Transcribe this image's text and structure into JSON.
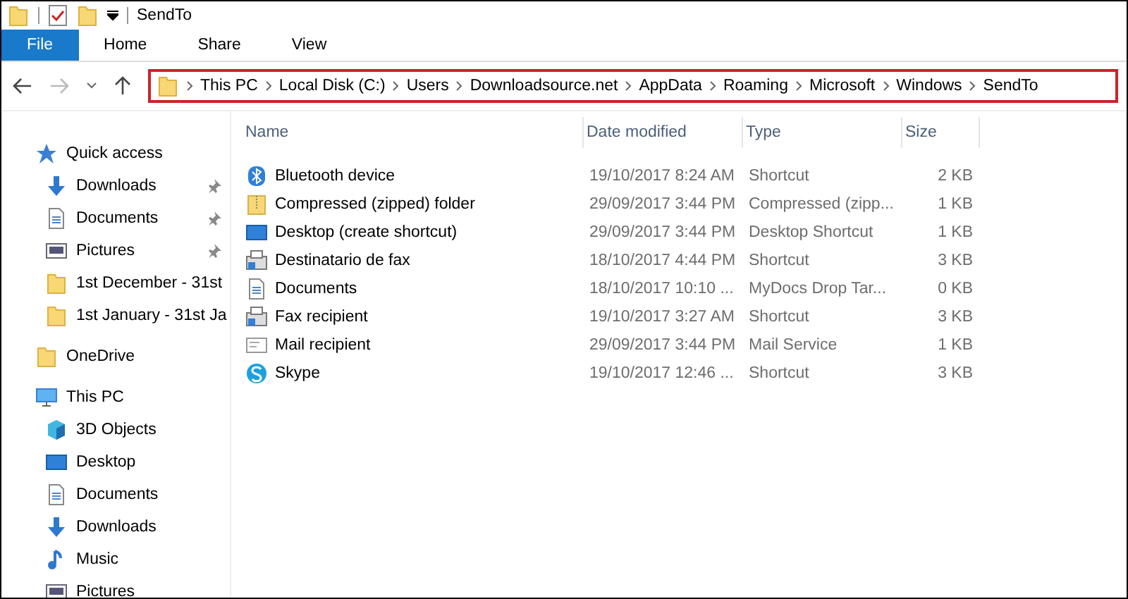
{
  "window": {
    "title": "SendTo"
  },
  "ribbon_tabs": [
    {
      "label": "File",
      "kind": "file",
      "selected": false
    },
    {
      "label": "Home",
      "kind": "tab",
      "selected": false
    },
    {
      "label": "Share",
      "kind": "tab",
      "selected": false
    },
    {
      "label": "View",
      "kind": "tab",
      "selected": false
    }
  ],
  "address_bar": {
    "highlighted": true,
    "path": [
      "This PC",
      "Local Disk (C:)",
      "Users",
      "Downloadsource.net",
      "AppData",
      "Roaming",
      "Microsoft",
      "Windows",
      "SendTo"
    ]
  },
  "sidebar": {
    "groups": [
      {
        "label": "Quick access",
        "kind": "star",
        "items": [
          {
            "label": "Downloads",
            "kind": "download",
            "pinned": true
          },
          {
            "label": "Documents",
            "kind": "document",
            "pinned": true
          },
          {
            "label": "Pictures",
            "kind": "picture",
            "pinned": true
          },
          {
            "label": "1st December - 31st",
            "kind": "folder",
            "pinned": false
          },
          {
            "label": "1st January - 31st Ja",
            "kind": "folder",
            "pinned": false
          }
        ]
      },
      {
        "label": "OneDrive",
        "kind": "folder"
      },
      {
        "label": "This PC",
        "kind": "pc",
        "items": [
          {
            "label": "3D Objects",
            "kind": "cube",
            "pinned": false
          },
          {
            "label": "Desktop",
            "kind": "desktop",
            "pinned": false
          },
          {
            "label": "Documents",
            "kind": "document",
            "pinned": false
          },
          {
            "label": "Downloads",
            "kind": "download",
            "pinned": false
          },
          {
            "label": "Music",
            "kind": "music",
            "pinned": false
          },
          {
            "label": "Pictures",
            "kind": "picture",
            "pinned": false
          }
        ]
      }
    ]
  },
  "file_list": {
    "columns": [
      "Name",
      "Date modified",
      "Type",
      "Size"
    ],
    "rows": [
      {
        "kind": "bluetooth",
        "name": "Bluetooth device",
        "date": "19/10/2017 8:24 AM",
        "type": "Shortcut",
        "size": "2 KB"
      },
      {
        "kind": "zip",
        "name": "Compressed (zipped) folder",
        "date": "29/09/2017 3:44 PM",
        "type": "Compressed (zipp...",
        "size": "1 KB"
      },
      {
        "kind": "desktop",
        "name": "Desktop (create shortcut)",
        "date": "29/09/2017 3:44 PM",
        "type": "Desktop Shortcut",
        "size": "1 KB"
      },
      {
        "kind": "fax",
        "name": "Destinatario de fax",
        "date": "18/10/2017 4:44 PM",
        "type": "Shortcut",
        "size": "3 KB"
      },
      {
        "kind": "document",
        "name": "Documents",
        "date": "18/10/2017 10:10 ...",
        "type": "MyDocs Drop Tar...",
        "size": "0 KB"
      },
      {
        "kind": "fax",
        "name": "Fax recipient",
        "date": "19/10/2017 3:27 AM",
        "type": "Shortcut",
        "size": "3 KB"
      },
      {
        "kind": "mail",
        "name": "Mail recipient",
        "date": "29/09/2017 3:44 PM",
        "type": "Mail Service",
        "size": "1 KB"
      },
      {
        "kind": "skype",
        "name": "Skype",
        "date": "19/10/2017 12:46 ...",
        "type": "Shortcut",
        "size": "3 KB"
      }
    ]
  }
}
